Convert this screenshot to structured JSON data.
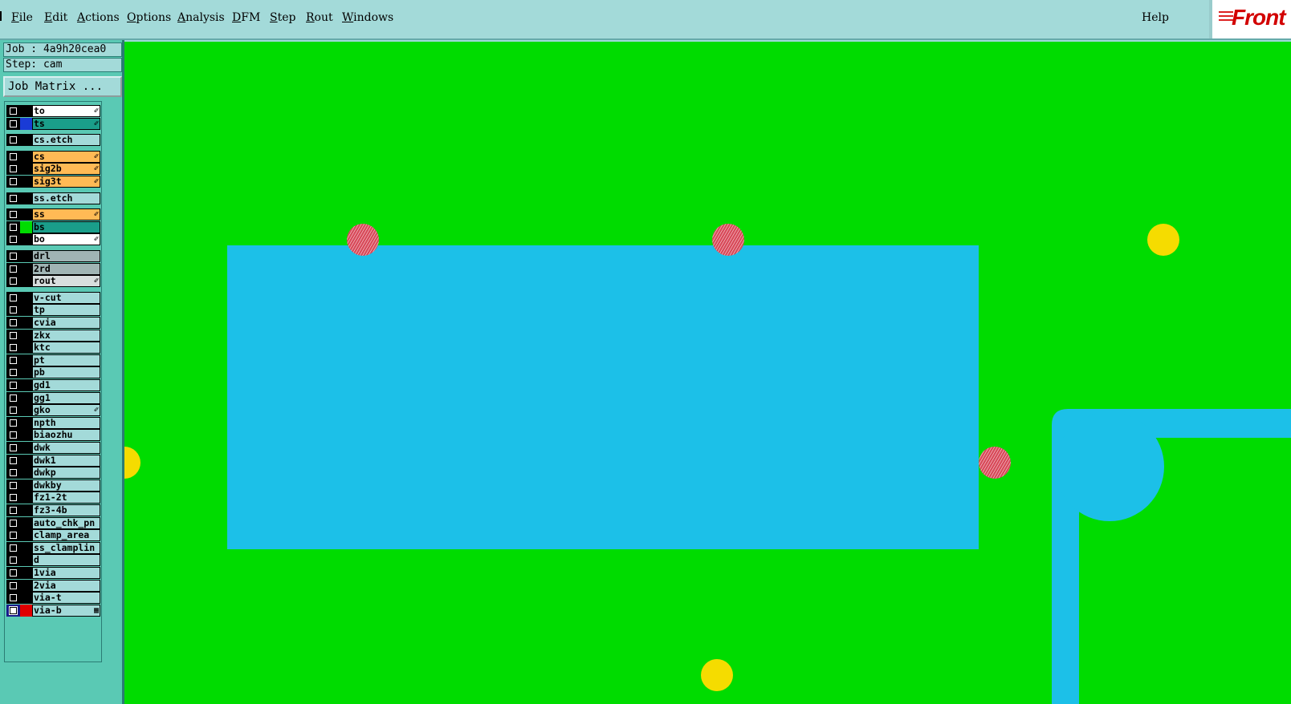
{
  "menubar": {
    "items": [
      {
        "label": "File"
      },
      {
        "label": "Edit"
      },
      {
        "label": "Actions"
      },
      {
        "label": "Options"
      },
      {
        "label": "Analysis"
      },
      {
        "label": "DFM"
      },
      {
        "label": "Step"
      },
      {
        "label": "Rout"
      },
      {
        "label": "Windows"
      }
    ],
    "help": "Help",
    "logo_text": "Front"
  },
  "panel": {
    "job": "Job : 4a9h20cea0",
    "step": "Step: cam",
    "job_matrix": "Job Matrix ..."
  },
  "layers": [
    {
      "name": "to",
      "bg": "#ffffff",
      "swatch": "#000000",
      "flag": "✐",
      "group": 0
    },
    {
      "name": "ts",
      "bg": "#1a9e8a",
      "swatch": "#1a3bd6",
      "flag": "✐",
      "group": 0
    },
    {
      "name": "cs.etch",
      "bg": "#a3dad9",
      "swatch": "#000000",
      "flag": "",
      "group": 1
    },
    {
      "name": "cs",
      "bg": "#ffba55",
      "swatch": "#000000",
      "flag": "✐",
      "group": 2
    },
    {
      "name": "sig2b",
      "bg": "#ffba55",
      "swatch": "#000000",
      "flag": "✐",
      "group": 2
    },
    {
      "name": "sig3t",
      "bg": "#ffba55",
      "swatch": "#000000",
      "flag": "✐",
      "group": 2
    },
    {
      "name": "ss.etch",
      "bg": "#a3dad9",
      "swatch": "#000000",
      "flag": "",
      "group": 3
    },
    {
      "name": "ss",
      "bg": "#ffba55",
      "swatch": "#000000",
      "flag": "✐",
      "group": 4
    },
    {
      "name": "bs",
      "bg": "#1a9e8a",
      "swatch": "#00dc00",
      "flag": "",
      "group": 4
    },
    {
      "name": "bo",
      "bg": "#ffffff",
      "swatch": "#000000",
      "flag": "✐",
      "group": 4
    },
    {
      "name": "drl",
      "bg": "#a0b4b4",
      "swatch": "#000000",
      "flag": "",
      "group": 5
    },
    {
      "name": "2rd",
      "bg": "#a0b4b4",
      "swatch": "#000000",
      "flag": "",
      "group": 5
    },
    {
      "name": "rout",
      "bg": "#d8dede",
      "swatch": "#000000",
      "flag": "✐",
      "group": 5
    },
    {
      "name": "v-cut",
      "bg": "#a3dad9",
      "swatch": "#000000",
      "flag": "",
      "group": 6
    },
    {
      "name": "tp",
      "bg": "#a3dad9",
      "swatch": "#000000",
      "flag": "",
      "group": 6
    },
    {
      "name": "cvia",
      "bg": "#a3dad9",
      "swatch": "#000000",
      "flag": "",
      "group": 6
    },
    {
      "name": "zkx",
      "bg": "#a3dad9",
      "swatch": "#000000",
      "flag": "",
      "group": 6
    },
    {
      "name": "ktc",
      "bg": "#a3dad9",
      "swatch": "#000000",
      "flag": "",
      "group": 6
    },
    {
      "name": "pt",
      "bg": "#a3dad9",
      "swatch": "#000000",
      "flag": "",
      "group": 6
    },
    {
      "name": "pb",
      "bg": "#a3dad9",
      "swatch": "#000000",
      "flag": "",
      "group": 6
    },
    {
      "name": "gd1",
      "bg": "#a3dad9",
      "swatch": "#000000",
      "flag": "",
      "group": 6
    },
    {
      "name": "gg1",
      "bg": "#a3dad9",
      "swatch": "#000000",
      "flag": "",
      "group": 6
    },
    {
      "name": "gko",
      "bg": "#a3dad9",
      "swatch": "#000000",
      "flag": "✐",
      "group": 6
    },
    {
      "name": "npth",
      "bg": "#a3dad9",
      "swatch": "#000000",
      "flag": "",
      "group": 6
    },
    {
      "name": "biaozhu",
      "bg": "#a3dad9",
      "swatch": "#000000",
      "flag": "",
      "group": 6
    },
    {
      "name": "dwk",
      "bg": "#a3dad9",
      "swatch": "#000000",
      "flag": "",
      "group": 6
    },
    {
      "name": "dwk1",
      "bg": "#a3dad9",
      "swatch": "#000000",
      "flag": "",
      "group": 6
    },
    {
      "name": "dwkp",
      "bg": "#a3dad9",
      "swatch": "#000000",
      "flag": "",
      "group": 6
    },
    {
      "name": "dwkby",
      "bg": "#a3dad9",
      "swatch": "#000000",
      "flag": "",
      "group": 6
    },
    {
      "name": "fz1-2t",
      "bg": "#a3dad9",
      "swatch": "#000000",
      "flag": "",
      "group": 6
    },
    {
      "name": "fz3-4b",
      "bg": "#a3dad9",
      "swatch": "#000000",
      "flag": "",
      "group": 6
    },
    {
      "name": "auto_chk_pn",
      "bg": "#a3dad9",
      "swatch": "#000000",
      "flag": "",
      "group": 6
    },
    {
      "name": "clamp_area",
      "bg": "#a3dad9",
      "swatch": "#000000",
      "flag": "",
      "group": 6
    },
    {
      "name": "ss_clamplin",
      "bg": "#a3dad9",
      "swatch": "#000000",
      "flag": "",
      "group": 6
    },
    {
      "name": "d",
      "bg": "#a3dad9",
      "swatch": "#000000",
      "flag": "",
      "group": 6
    },
    {
      "name": "1via",
      "bg": "#a3dad9",
      "swatch": "#000000",
      "flag": "",
      "group": 6
    },
    {
      "name": "2via",
      "bg": "#a3dad9",
      "swatch": "#000000",
      "flag": "",
      "group": 6
    },
    {
      "name": "via-t",
      "bg": "#a3dad9",
      "swatch": "#000000",
      "flag": "",
      "group": 6
    },
    {
      "name": "via-b",
      "bg": "#a3dad9",
      "swatch": "#e00000",
      "flag": "▦",
      "group": 6,
      "selected": true
    }
  ],
  "colors": {
    "canvas_bg": "#00dc00",
    "copper": "#1cc0e8",
    "pad_yellow": "#f5dc00",
    "pad_red": "#d84a5a"
  }
}
